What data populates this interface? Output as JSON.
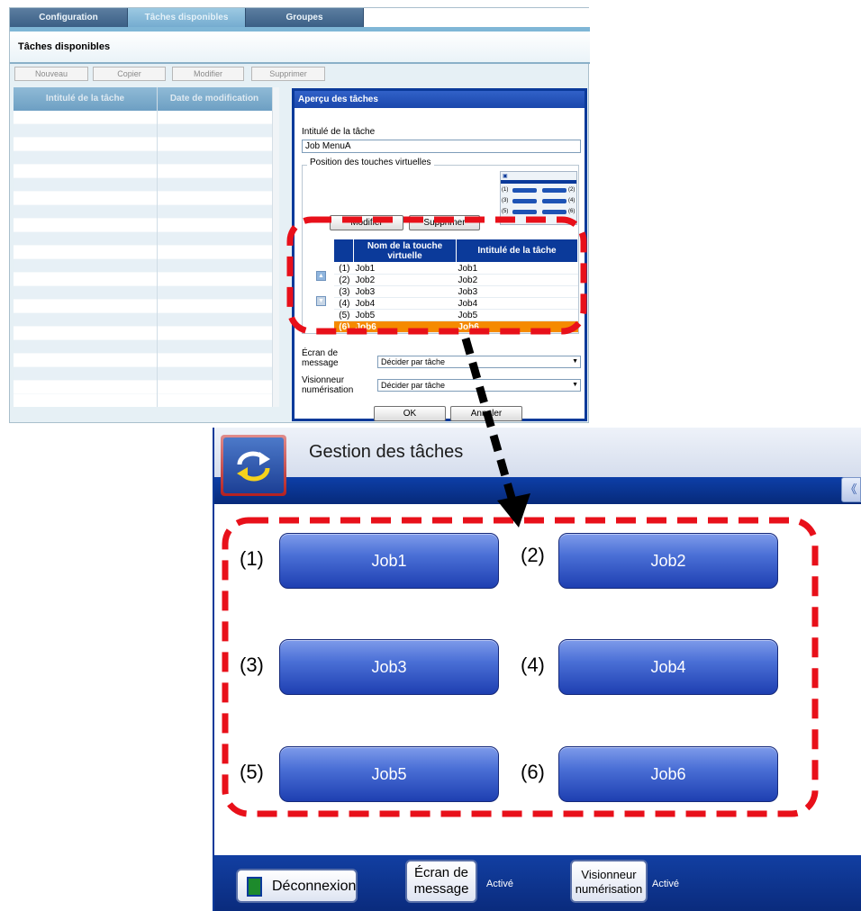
{
  "admin": {
    "tabs": [
      "Configuration",
      "Tâches disponibles",
      "Groupes"
    ],
    "title": "Tâches disponibles",
    "toolbar": {
      "new": "Nouveau",
      "copy": "Copier",
      "edit": "Modifier",
      "delete": "Supprimer"
    },
    "tasklist": {
      "col_title": "Intitulé de la tâche",
      "col_date": "Date de modification"
    }
  },
  "preview": {
    "header": "Aperçu des tâches",
    "task_title_label": "Intitulé de la tâche",
    "task_title_value": "Job MenuA",
    "group_label": "Position des touches virtuelles",
    "edit_button": "Modifier",
    "delete_button": "Supprimer",
    "mini_labels": [
      "(1)",
      "(2)",
      "(3)",
      "(4)",
      "(5)",
      "(6)"
    ],
    "table": {
      "col_key": "Nom de la touche virtuelle",
      "col_task": "Intitulé de la tâche",
      "rows": [
        {
          "num": "(1)",
          "key": "Job1",
          "task": "Job1"
        },
        {
          "num": "(2)",
          "key": "Job2",
          "task": "Job2"
        },
        {
          "num": "(3)",
          "key": "Job3",
          "task": "Job3"
        },
        {
          "num": "(4)",
          "key": "Job4",
          "task": "Job4"
        },
        {
          "num": "(5)",
          "key": "Job5",
          "task": "Job5"
        },
        {
          "num": "(6)",
          "key": "Job6",
          "task": "Job6"
        }
      ]
    },
    "message_screen_label_1": "Écran de",
    "message_screen_label_2": "message",
    "message_screen_value": "Décider par tâche",
    "scan_viewer_label_1": "Visionneur",
    "scan_viewer_label_2": "numérisation",
    "scan_viewer_value": "Décider par tâche",
    "ok_button": "OK",
    "cancel_button": "Annuler"
  },
  "touch": {
    "title": "Gestion des tâches",
    "collapse": "《",
    "buttons": [
      {
        "num": "(1)",
        "label": "Job1"
      },
      {
        "num": "(2)",
        "label": "Job2"
      },
      {
        "num": "(3)",
        "label": "Job3"
      },
      {
        "num": "(4)",
        "label": "Job4"
      },
      {
        "num": "(5)",
        "label": "Job5"
      },
      {
        "num": "(6)",
        "label": "Job6"
      }
    ],
    "footer": {
      "logout": "Déconnexion",
      "message_screen_1": "Écran de",
      "message_screen_2": "message",
      "message_status": "Activé",
      "scan_viewer_1": "Visionneur",
      "scan_viewer_2": "numérisation",
      "scan_status": "Activé"
    }
  },
  "colors": {
    "selected_row": "#f58a00",
    "annotation_dash": "#e8101a",
    "panel_blue": "#0b3a9a"
  },
  "icons": [
    "refresh-arrows-icon",
    "logout-door-icon",
    "up-arrow-icon",
    "down-arrow-icon",
    "dropdown-arrow-icon"
  ]
}
